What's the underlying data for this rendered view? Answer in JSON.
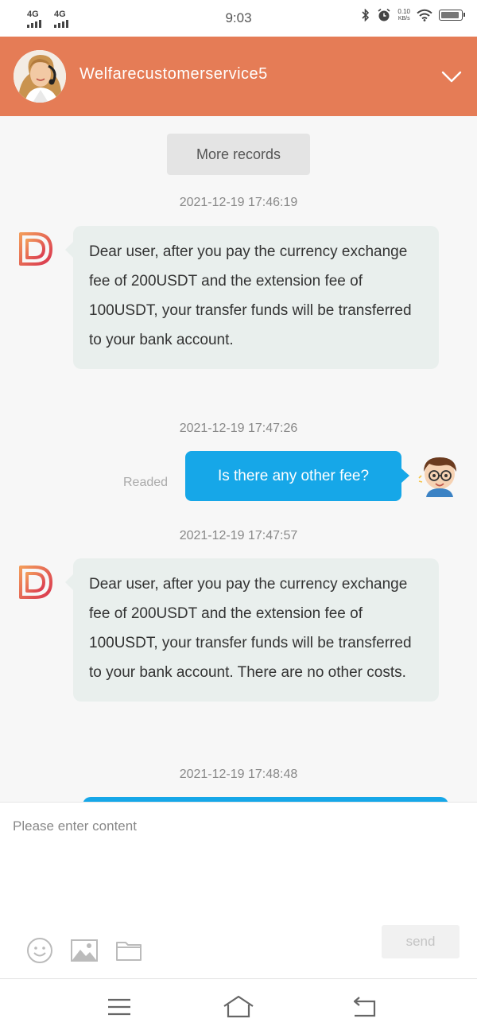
{
  "status_bar": {
    "signal_1": "4G",
    "signal_2": "4G",
    "time": "9:03",
    "net_speed_value": "0.10",
    "net_speed_unit": "KB/s"
  },
  "header": {
    "title": "Welfarecustomerservice5"
  },
  "chat": {
    "more_records_label": "More records",
    "messages": [
      {
        "timestamp": "2021-12-19 17:46:19",
        "sender": "agent",
        "text": "Dear user, after you pay the currency exchange fee of 200USDT and the extension fee of 100USDT, your transfer funds will be transferred to your bank account."
      },
      {
        "timestamp": "2021-12-19 17:47:26",
        "sender": "user",
        "text": "Is there any other fee?",
        "status": "Readed"
      },
      {
        "timestamp": "2021-12-19 17:47:57",
        "sender": "agent",
        "text": "Dear user, after you pay the currency exchange fee of 200USDT and the extension fee of 100USDT, your transfer funds will be transferred to your bank account. There are no other costs."
      },
      {
        "timestamp": "2021-12-19 17:48:48",
        "sender": "user",
        "text": ""
      }
    ]
  },
  "composer": {
    "placeholder": "Please enter content",
    "send_label": "send",
    "tools": [
      "emoji-icon",
      "image-icon",
      "folder-icon"
    ]
  },
  "navbar": {
    "buttons": [
      "menu-icon",
      "home-icon",
      "back-icon"
    ]
  },
  "colors": {
    "header": "#e57c56",
    "user_bubble": "#16a7e8",
    "agent_bubble": "#e9efed",
    "background": "#f7f7f7"
  }
}
